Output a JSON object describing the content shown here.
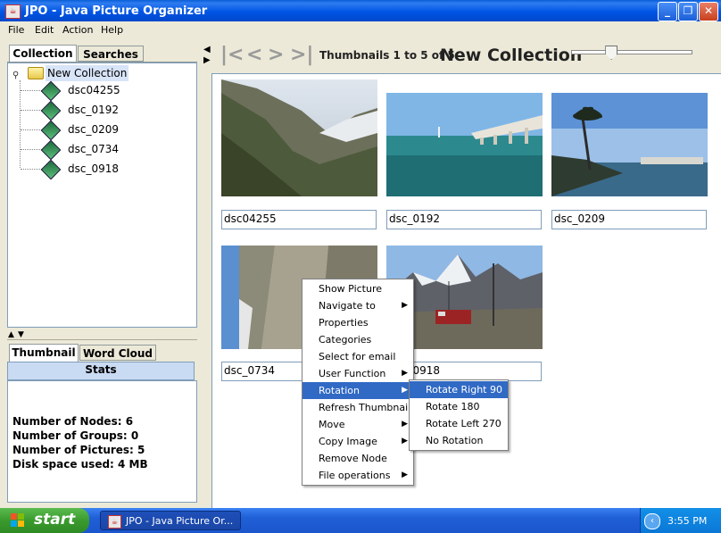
{
  "window": {
    "title": "JPO - Java Picture Organizer",
    "app_icon": "java-cup-icon",
    "buttons": [
      "minimize-icon",
      "maximize-icon",
      "close-icon"
    ]
  },
  "menubar": [
    "File",
    "Edit",
    "Action",
    "Help"
  ],
  "left_tabs_top": [
    "Collection",
    "Searches"
  ],
  "tree": {
    "root": "New Collection",
    "items": [
      "dsc04255",
      "dsc_0192",
      "dsc_0209",
      "dsc_0734",
      "dsc_0918"
    ]
  },
  "left_tabs_bottom": [
    "Thumbnail",
    "Word Cloud",
    "Stats"
  ],
  "stats": [
    "Number of Nodes: 6",
    "Number of Groups: 0",
    "Number of Pictures: 5",
    "Disk space used: 4 MB"
  ],
  "toolbar": {
    "nav_icons": [
      "first-icon",
      "previous-icon",
      "next-icon",
      "last-icon"
    ],
    "thumb_count": "Thumbnails 1 to 5 of 5",
    "collection_title": "New Collection",
    "zoom_level": 0.33
  },
  "thumbnails": [
    {
      "caption": "dsc04255",
      "scene": "mountain valley"
    },
    {
      "caption": "dsc_0192",
      "scene": "bridge over sea"
    },
    {
      "caption": "dsc_0209",
      "scene": "palm tree beach"
    },
    {
      "caption": "dsc_0734",
      "scene": "rotated mountain"
    },
    {
      "caption": "dsc_0918",
      "scene": "alpine train"
    }
  ],
  "context_menu": [
    {
      "label": "Show Picture",
      "submenu": false
    },
    {
      "label": "Navigate to",
      "submenu": true
    },
    {
      "label": "Properties",
      "submenu": false
    },
    {
      "label": "Categories",
      "submenu": false
    },
    {
      "label": "Select for email",
      "submenu": false
    },
    {
      "label": "User Function",
      "submenu": true
    },
    {
      "label": "Rotation",
      "submenu": true,
      "highlighted": true
    },
    {
      "label": "Refresh Thumbnail",
      "submenu": false
    },
    {
      "label": "Move",
      "submenu": true
    },
    {
      "label": "Copy Image",
      "submenu": true
    },
    {
      "label": "Remove Node",
      "submenu": false
    },
    {
      "label": "File operations",
      "submenu": true
    }
  ],
  "rotation_submenu": [
    {
      "label": "Rotate Right 90",
      "highlighted": true
    },
    {
      "label": "Rotate 180"
    },
    {
      "label": "Rotate Left 270"
    },
    {
      "label": "No Rotation"
    }
  ],
  "taskbar": {
    "start_label": "start",
    "task_label": "JPO - Java Picture Or...",
    "clock": "3:55 PM"
  },
  "colors": {
    "titlebar": "#0055e5",
    "menu_highlight": "#316ac5",
    "taskbar": "#1f5fd6",
    "start_green": "#3a9a2e"
  }
}
